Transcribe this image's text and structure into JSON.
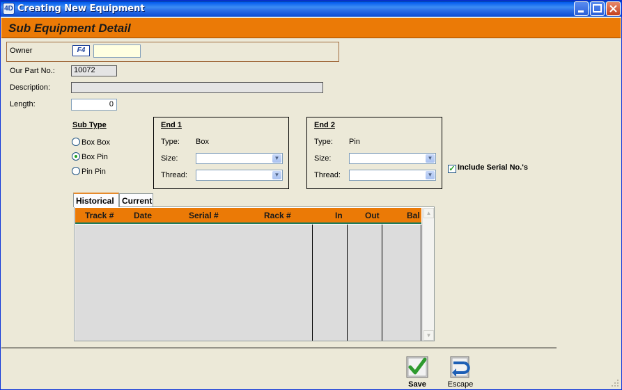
{
  "window": {
    "title": "Creating New Equipment",
    "app_icon": "4D"
  },
  "header": {
    "title": "Sub Equipment Detail"
  },
  "owner": {
    "label": "Owner",
    "lookup_button": "F4",
    "value": ""
  },
  "fields": {
    "part_no_label": "Our Part No.:",
    "part_no_value": "10072",
    "description_label": "Description:",
    "description_value": "",
    "length_label": "Length:",
    "length_value": "0"
  },
  "sub_type": {
    "title": "Sub Type",
    "options": [
      "Box Box",
      "Box Pin",
      "Pin Pin"
    ],
    "selected": "Box Pin"
  },
  "end1": {
    "title": "End 1",
    "type_label": "Type:",
    "type_value": "Box",
    "size_label": "Size:",
    "thread_label": "Thread:",
    "size_value": "",
    "thread_value": ""
  },
  "end2": {
    "title": "End 2",
    "type_label": "Type:",
    "type_value": "Pin",
    "size_label": "Size:",
    "thread_label": "Thread:",
    "size_value": "",
    "thread_value": ""
  },
  "include_serial": {
    "label": "Include Serial No.'s",
    "checked": true
  },
  "tabs": [
    {
      "label": "Historical",
      "active": true
    },
    {
      "label": "Current",
      "active": false
    }
  ],
  "table": {
    "columns": [
      "Track #",
      "Date",
      "Serial #",
      "Rack #",
      "In",
      "Out",
      "Bal"
    ],
    "rows": []
  },
  "actions": {
    "save_label": "Save",
    "escape_label": "Escape"
  },
  "colors": {
    "accent": "#EB7A06",
    "titlebar": "#2C6FE6",
    "check_green": "#21A121"
  }
}
